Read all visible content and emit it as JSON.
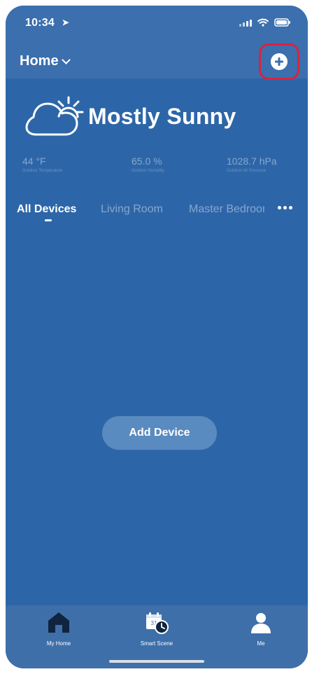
{
  "status_bar": {
    "time": "10:34",
    "location_icon": "location-arrow-icon"
  },
  "header": {
    "home_label": "Home",
    "add_button_icon": "plus-circle-icon"
  },
  "weather": {
    "title": "Mostly Sunny",
    "icon": "partly-sunny-icon",
    "metrics": [
      {
        "value": "44 °F",
        "label": "Outdoor Temperature"
      },
      {
        "value": "65.0 %",
        "label": "Outdoor Humidity"
      },
      {
        "value": "1028.7 hPa",
        "label": "Outdoor Air Pressure"
      }
    ]
  },
  "tabs": {
    "items": [
      "All Devices",
      "Living Room",
      "Master Bedroom"
    ],
    "more_icon": "more-dots-icon"
  },
  "main": {
    "add_device_label": "Add Device"
  },
  "bottom_nav": {
    "items": [
      {
        "label": "My Home",
        "icon": "home-icon"
      },
      {
        "label": "Smart Scene",
        "icon": "calendar-clock-icon"
      },
      {
        "label": "Me",
        "icon": "person-icon"
      }
    ]
  },
  "colors": {
    "screen_bg": "#2d66a8",
    "header_bg": "#3b6fae",
    "button_bg": "#5a8bc0",
    "highlight": "#d9233f"
  }
}
